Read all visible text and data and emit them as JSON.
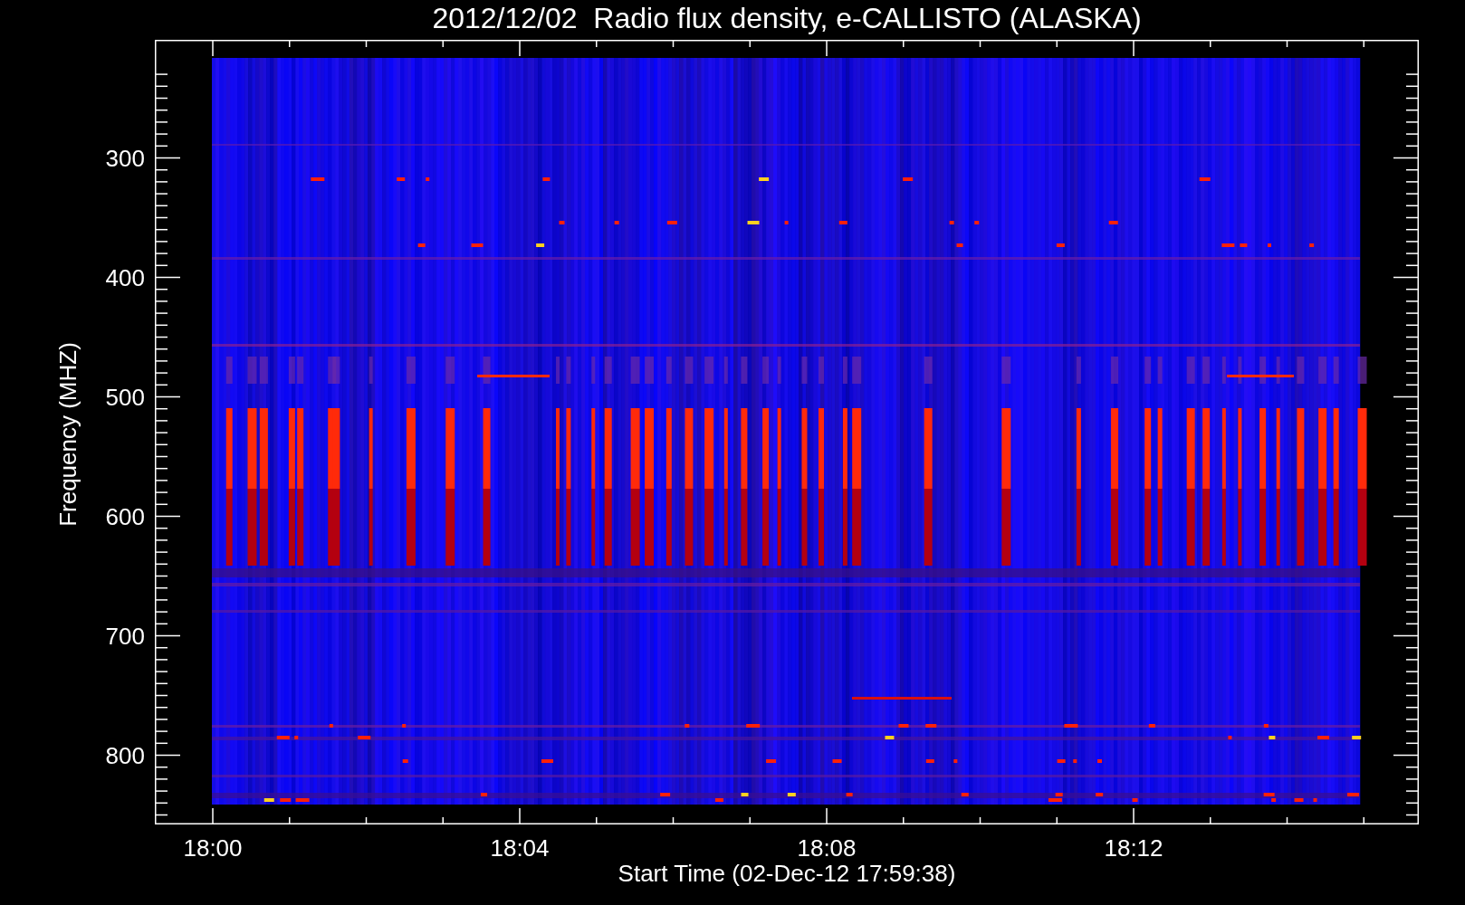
{
  "title": "2012/12/02  Radio flux density, e-CALLISTO (ALASKA)",
  "y_axis": {
    "label": "Frequency (MHZ)",
    "ticks": [
      "300",
      "400",
      "500",
      "600",
      "700",
      "800"
    ]
  },
  "x_axis": {
    "label": "Start Time (02-Dec-12 17:59:38)",
    "ticks": [
      "18:00",
      "18:04",
      "18:08",
      "18:12"
    ]
  }
}
